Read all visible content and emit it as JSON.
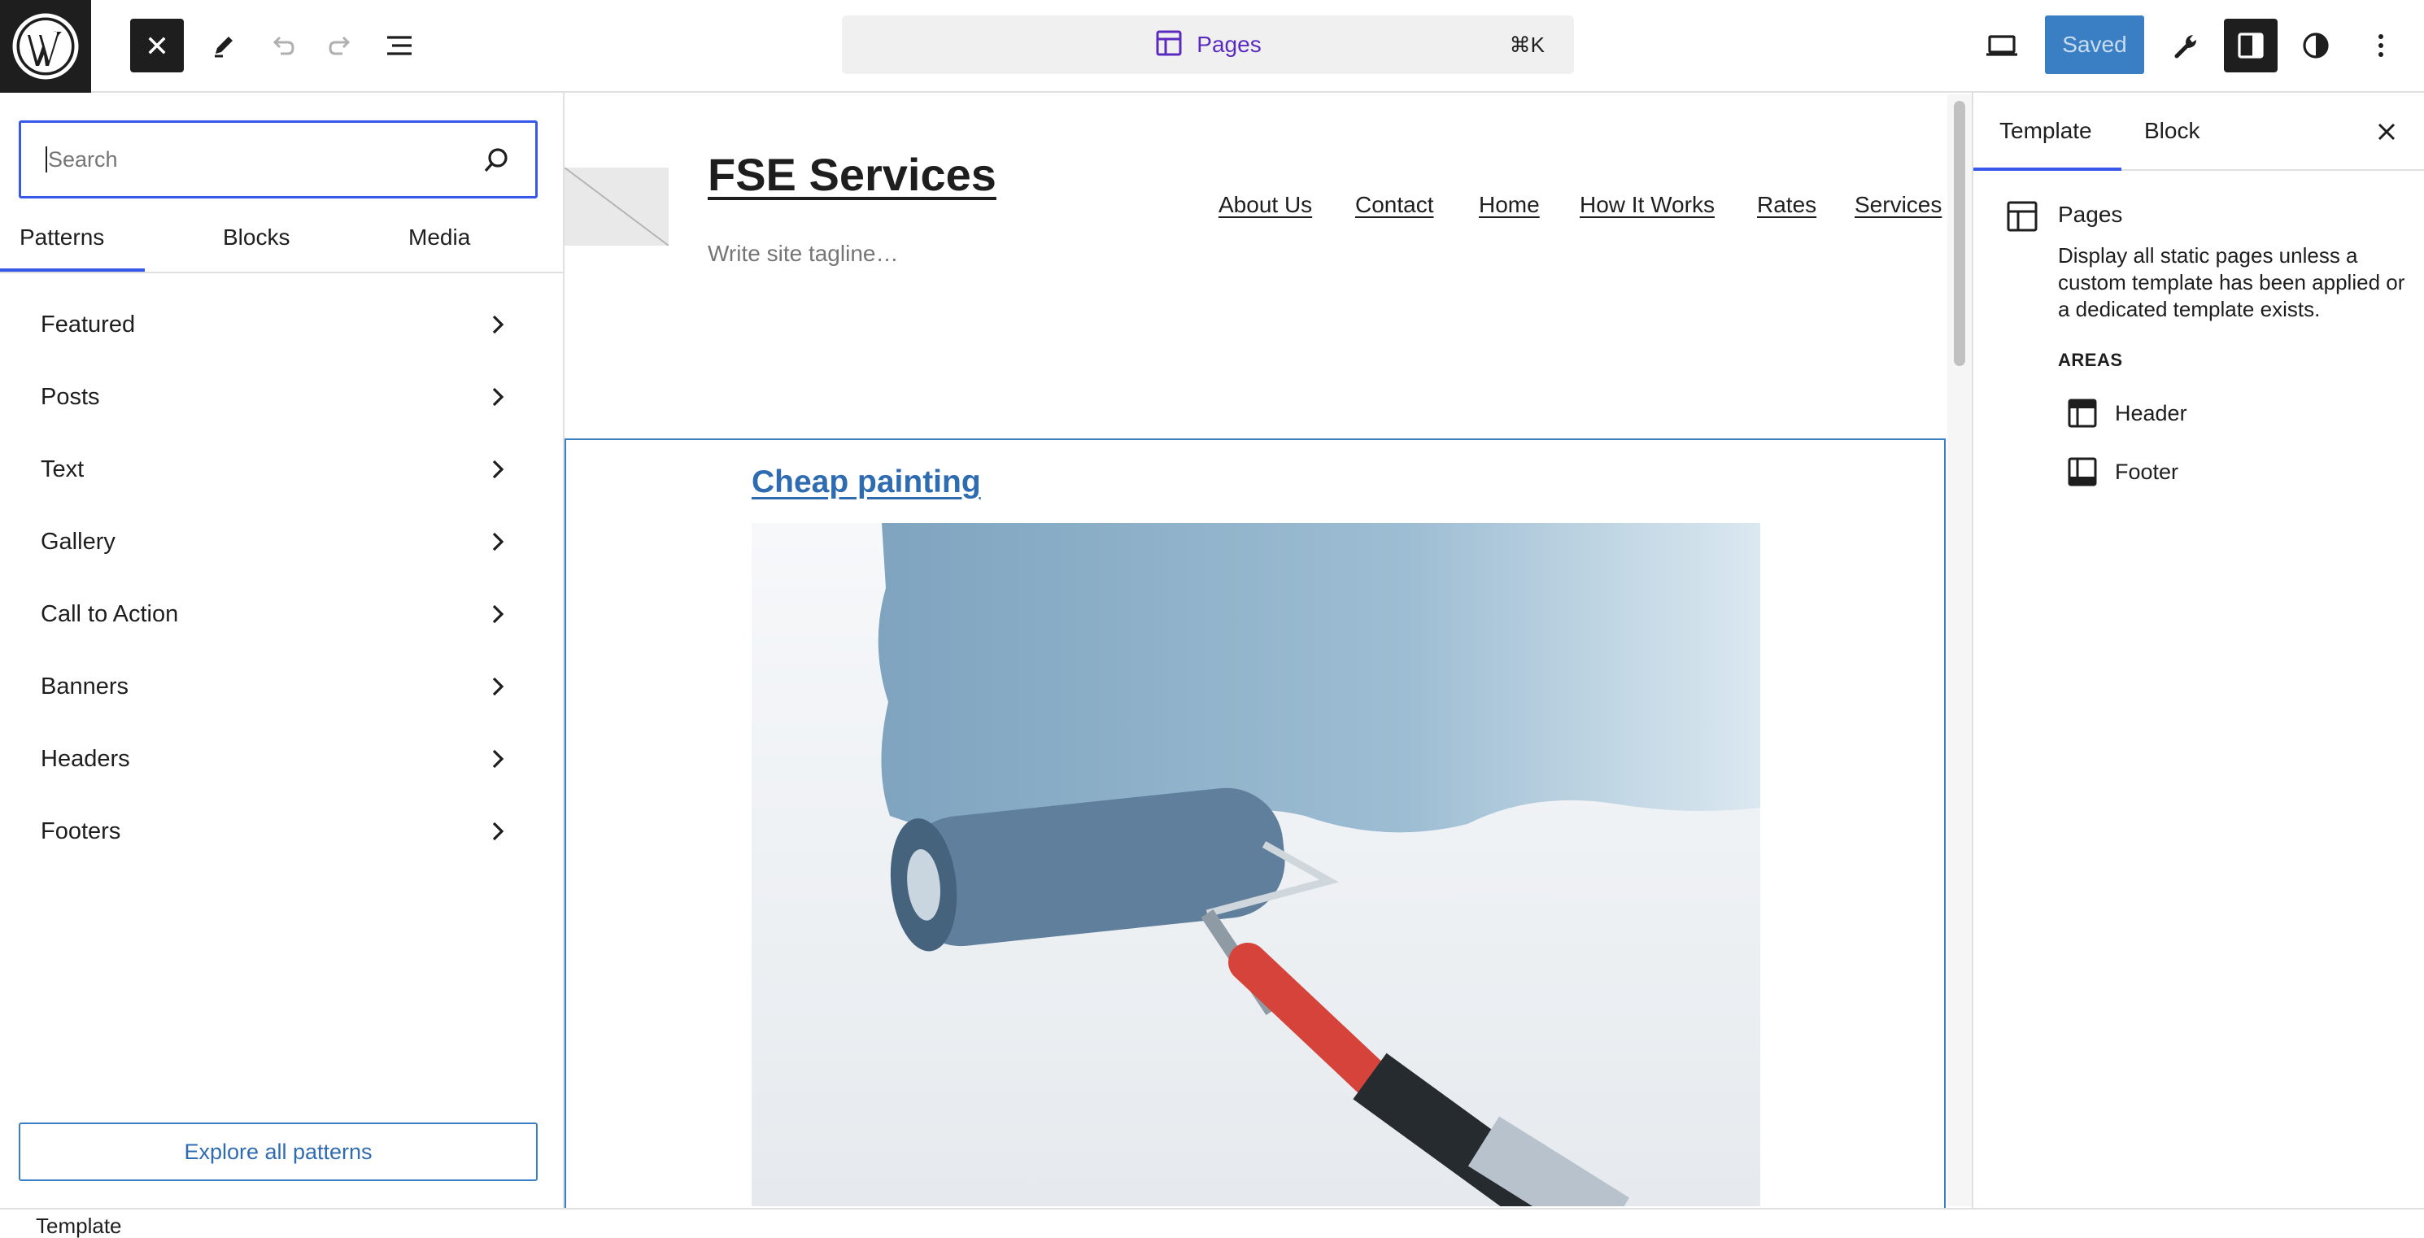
{
  "topbar": {
    "logo_icon": "wordpress-logo",
    "close_icon": "close-icon",
    "tools": [
      "pencil-icon",
      "undo-icon",
      "redo-icon",
      "list-view-icon"
    ],
    "command_bar": {
      "icon": "template-icon",
      "title": "Pages",
      "shortcut": "⌘K"
    },
    "saved_label": "Saved",
    "right_icons": [
      "desktop-preview-icon",
      "wrench-icon",
      "sidebar-toggle-icon",
      "styles-icon",
      "more-options-icon"
    ]
  },
  "inserter": {
    "search": {
      "placeholder": "Search",
      "value": ""
    },
    "tabs": [
      "Patterns",
      "Blocks",
      "Media"
    ],
    "active_tab": "Patterns",
    "categories": [
      "Featured",
      "Posts",
      "Text",
      "Gallery",
      "Call to Action",
      "Banners",
      "Headers",
      "Footers"
    ],
    "explore_label": "Explore all patterns"
  },
  "canvas": {
    "site_title": "FSE Services",
    "site_tagline": "Write site tagline…",
    "nav": [
      "About Us",
      "Contact",
      "Home",
      "How It Works",
      "Rates",
      "Services"
    ],
    "post_title": "Cheap painting",
    "post_image": "paint-roller-image"
  },
  "sidebar": {
    "tabs": [
      "Template",
      "Block"
    ],
    "active_tab": "Template",
    "template_name": "Pages",
    "template_description": "Display all static pages unless a custom template has been applied or a dedicated template exists.",
    "areas_label": "AREAS",
    "areas": [
      "Header",
      "Footer"
    ]
  },
  "footer": {
    "breadcrumb": "Template"
  },
  "colors": {
    "accent": "#3858e9",
    "saved_button": "#3a7fc4",
    "command_title": "#5b2bbf",
    "link": "#2e6bb0"
  }
}
